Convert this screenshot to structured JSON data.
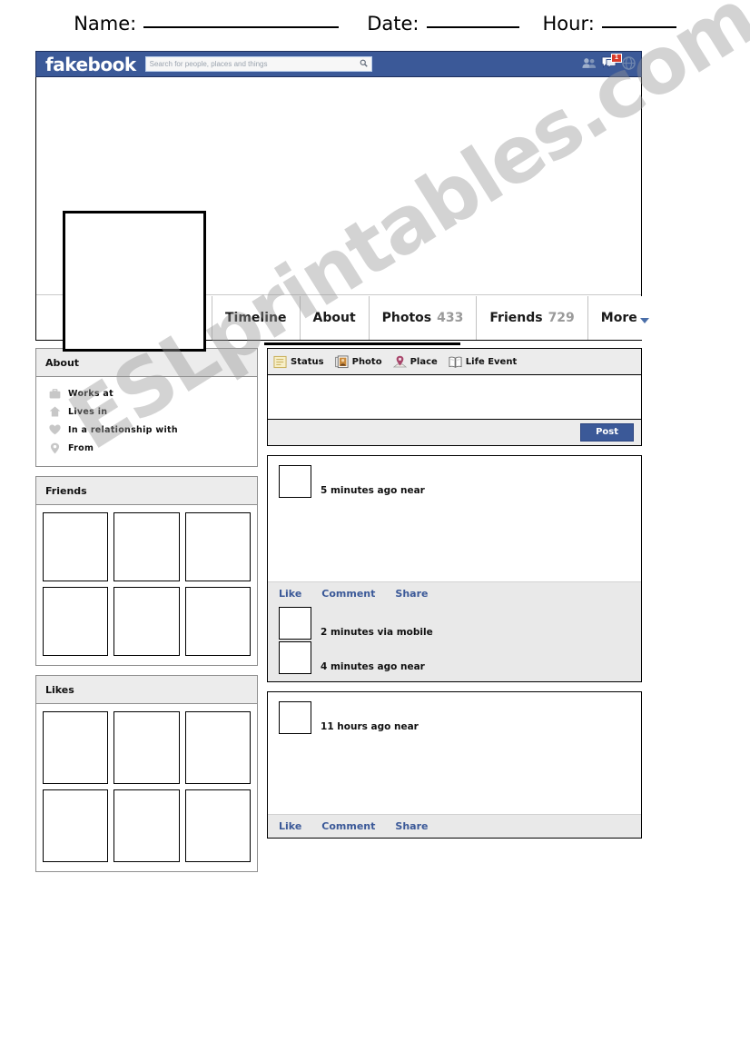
{
  "worksheet": {
    "name_label": "Name:",
    "date_label": "Date:",
    "hour_label": "Hour:"
  },
  "topbar": {
    "logo": "fakebook",
    "search_placeholder": "Search for people, places and things",
    "search_value": "",
    "search_icon": "search-icon",
    "icons": [
      {
        "name": "friend-requests-icon",
        "badge": ""
      },
      {
        "name": "messages-icon",
        "badge": "1"
      },
      {
        "name": "notifications-globe-icon",
        "badge": ""
      }
    ]
  },
  "profile": {
    "cover_photo": "",
    "profile_picture": "",
    "name_value": ""
  },
  "tabs": [
    {
      "label": "Timeline",
      "count": ""
    },
    {
      "label": "About",
      "count": ""
    },
    {
      "label": "Photos",
      "count": "433"
    },
    {
      "label": "Friends",
      "count": "729"
    },
    {
      "label": "More",
      "count": ""
    }
  ],
  "about_panel": {
    "title": "About",
    "rows": [
      {
        "icon": "briefcase-icon",
        "label": "Works at"
      },
      {
        "icon": "home-icon",
        "label": "Lives in"
      },
      {
        "icon": "heart-icon",
        "label": "In a relationship with"
      },
      {
        "icon": "map-pin-icon",
        "label": "From"
      }
    ]
  },
  "friends_panel": {
    "title": "Friends",
    "cells": [
      "",
      "",
      "",
      "",
      "",
      ""
    ]
  },
  "likes_panel": {
    "title": "Likes",
    "cells": [
      "",
      "",
      "",
      "",
      "",
      ""
    ]
  },
  "composer": {
    "items": [
      {
        "icon": "status-note-icon",
        "label": "Status"
      },
      {
        "icon": "photo-icon",
        "label": "Photo"
      },
      {
        "icon": "place-pin-icon",
        "label": "Place"
      },
      {
        "icon": "life-event-book-icon",
        "label": "Life Event"
      }
    ],
    "text_value": "",
    "post_label": "Post"
  },
  "posts": [
    {
      "meta": "5 minutes ago near",
      "actions": [
        "Like",
        "Comment",
        "Share"
      ],
      "comments": [
        {
          "meta": "2 minutes via mobile"
        },
        {
          "meta": "4 minutes ago near"
        }
      ]
    },
    {
      "meta": "11 hours ago near",
      "actions": [
        "Like",
        "Comment",
        "Share"
      ],
      "comments": []
    }
  ],
  "watermark": {
    "text": "ESLprintables.com"
  },
  "colors": {
    "brand_blue": "#3b5998",
    "badge_red": "#d93a2b",
    "panel_gray": "#ececec",
    "action_bar_gray": "#e9e9e9",
    "count_gray": "#9a9a9a"
  }
}
